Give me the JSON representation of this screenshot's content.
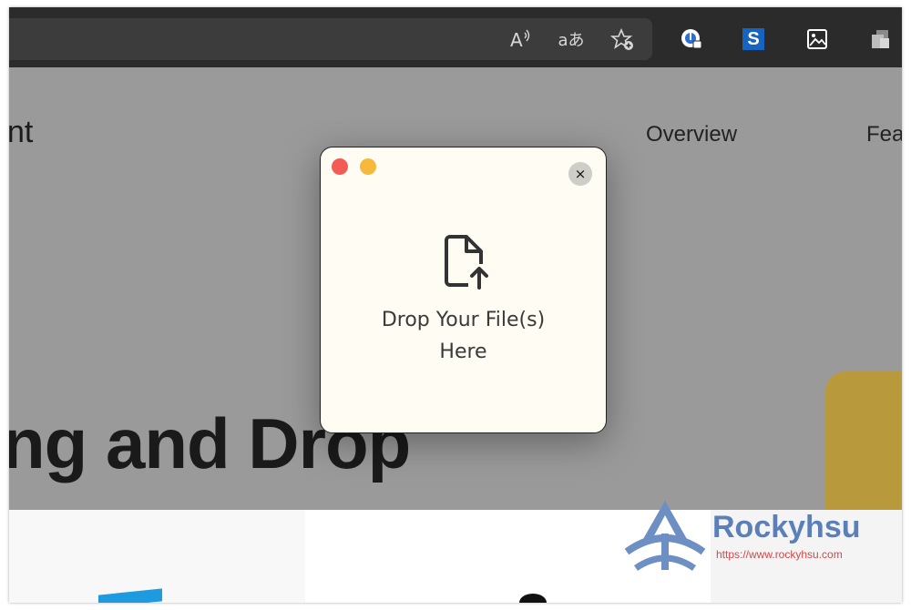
{
  "toolbar": {
    "icons": [
      "read-aloud-icon",
      "translate-icon",
      "add-favorite-icon",
      "extension-lock-icon",
      "extension-s-icon",
      "extension-image-icon",
      "extension-copy-icon"
    ],
    "extension_s_label": "S",
    "translate_label": "aあ",
    "read_aloud_label": "A"
  },
  "page": {
    "partial_logo": "nt",
    "nav": [
      "Overview",
      "Fea"
    ],
    "hero_text": "ng and Drop"
  },
  "dialog": {
    "drop_line1": "Drop Your File(s)",
    "drop_line2": "Here",
    "close_label": "×"
  },
  "watermark": {
    "title": "Rockyhsu",
    "url": "https://www.rockyhsu.com"
  },
  "colors": {
    "accent_red": "#f25c54",
    "accent_yellow": "#f6b93b",
    "dialog_bg": "#fffcf3",
    "watermark_blue": "#5b7fb8"
  }
}
